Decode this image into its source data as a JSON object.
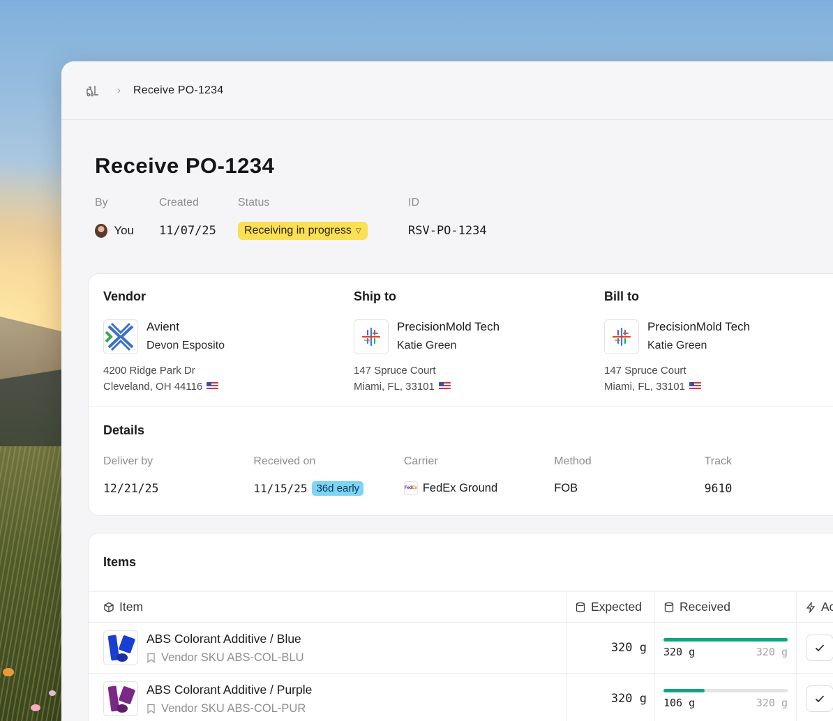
{
  "breadcrumb": {
    "icon": "forklift-icon",
    "current": "Receive PO-1234"
  },
  "page": {
    "title": "Receive PO-1234",
    "meta": {
      "by": {
        "label": "By",
        "value": "You"
      },
      "created": {
        "label": "Created",
        "value": "11/07/25"
      },
      "status": {
        "label": "Status",
        "value": "Receiving in progress",
        "color": "#fbdf55"
      },
      "id": {
        "label": "ID",
        "value": "RSV-PO-1234"
      }
    }
  },
  "vendor": {
    "title": "Vendor",
    "name": "Avient",
    "person": "Devon Esposito",
    "address1": "4200 Ridge Park Dr",
    "address2": "Cleveland, OH 44116"
  },
  "ship_to": {
    "title": "Ship to",
    "name": "PrecisionMold Tech",
    "person": "Katie Green",
    "address1": "147 Spruce Court",
    "address2": "Miami, FL, 33101"
  },
  "bill_to": {
    "title": "Bill to",
    "name": "PrecisionMold Tech",
    "person": "Katie Green",
    "address1": "147 Spruce Court",
    "address2": "Miami, FL, 33101"
  },
  "details": {
    "title": "Details",
    "deliver_by": {
      "label": "Deliver by",
      "value": "12/21/25"
    },
    "received_on": {
      "label": "Received on",
      "value": "11/15/25",
      "badge": "36d early"
    },
    "carrier": {
      "label": "Carrier",
      "value": "FedEx Ground"
    },
    "method": {
      "label": "Method",
      "value": "FOB"
    },
    "tracking": {
      "label": "Track",
      "value": "9610"
    }
  },
  "items": {
    "title": "Items",
    "columns": {
      "item": "Item",
      "expected": "Expected",
      "received": "Received",
      "actions": "Ac"
    },
    "rows": [
      {
        "name": "ABS Colorant Additive / Blue",
        "sku": "Vendor SKU ABS-COL-BLU",
        "expected": "320 g",
        "received": "320 g",
        "of": "320 g",
        "progress": 1.0,
        "color": "#1a3fd0"
      },
      {
        "name": "ABS Colorant Additive / Purple",
        "sku": "Vendor SKU ABS-COL-PUR",
        "expected": "320 g",
        "received": "106 g",
        "of": "320 g",
        "progress": 0.33,
        "color": "#7a2a86"
      }
    ]
  },
  "colors": {
    "progress": "#12a37f",
    "badge": "#7fd3f4"
  }
}
